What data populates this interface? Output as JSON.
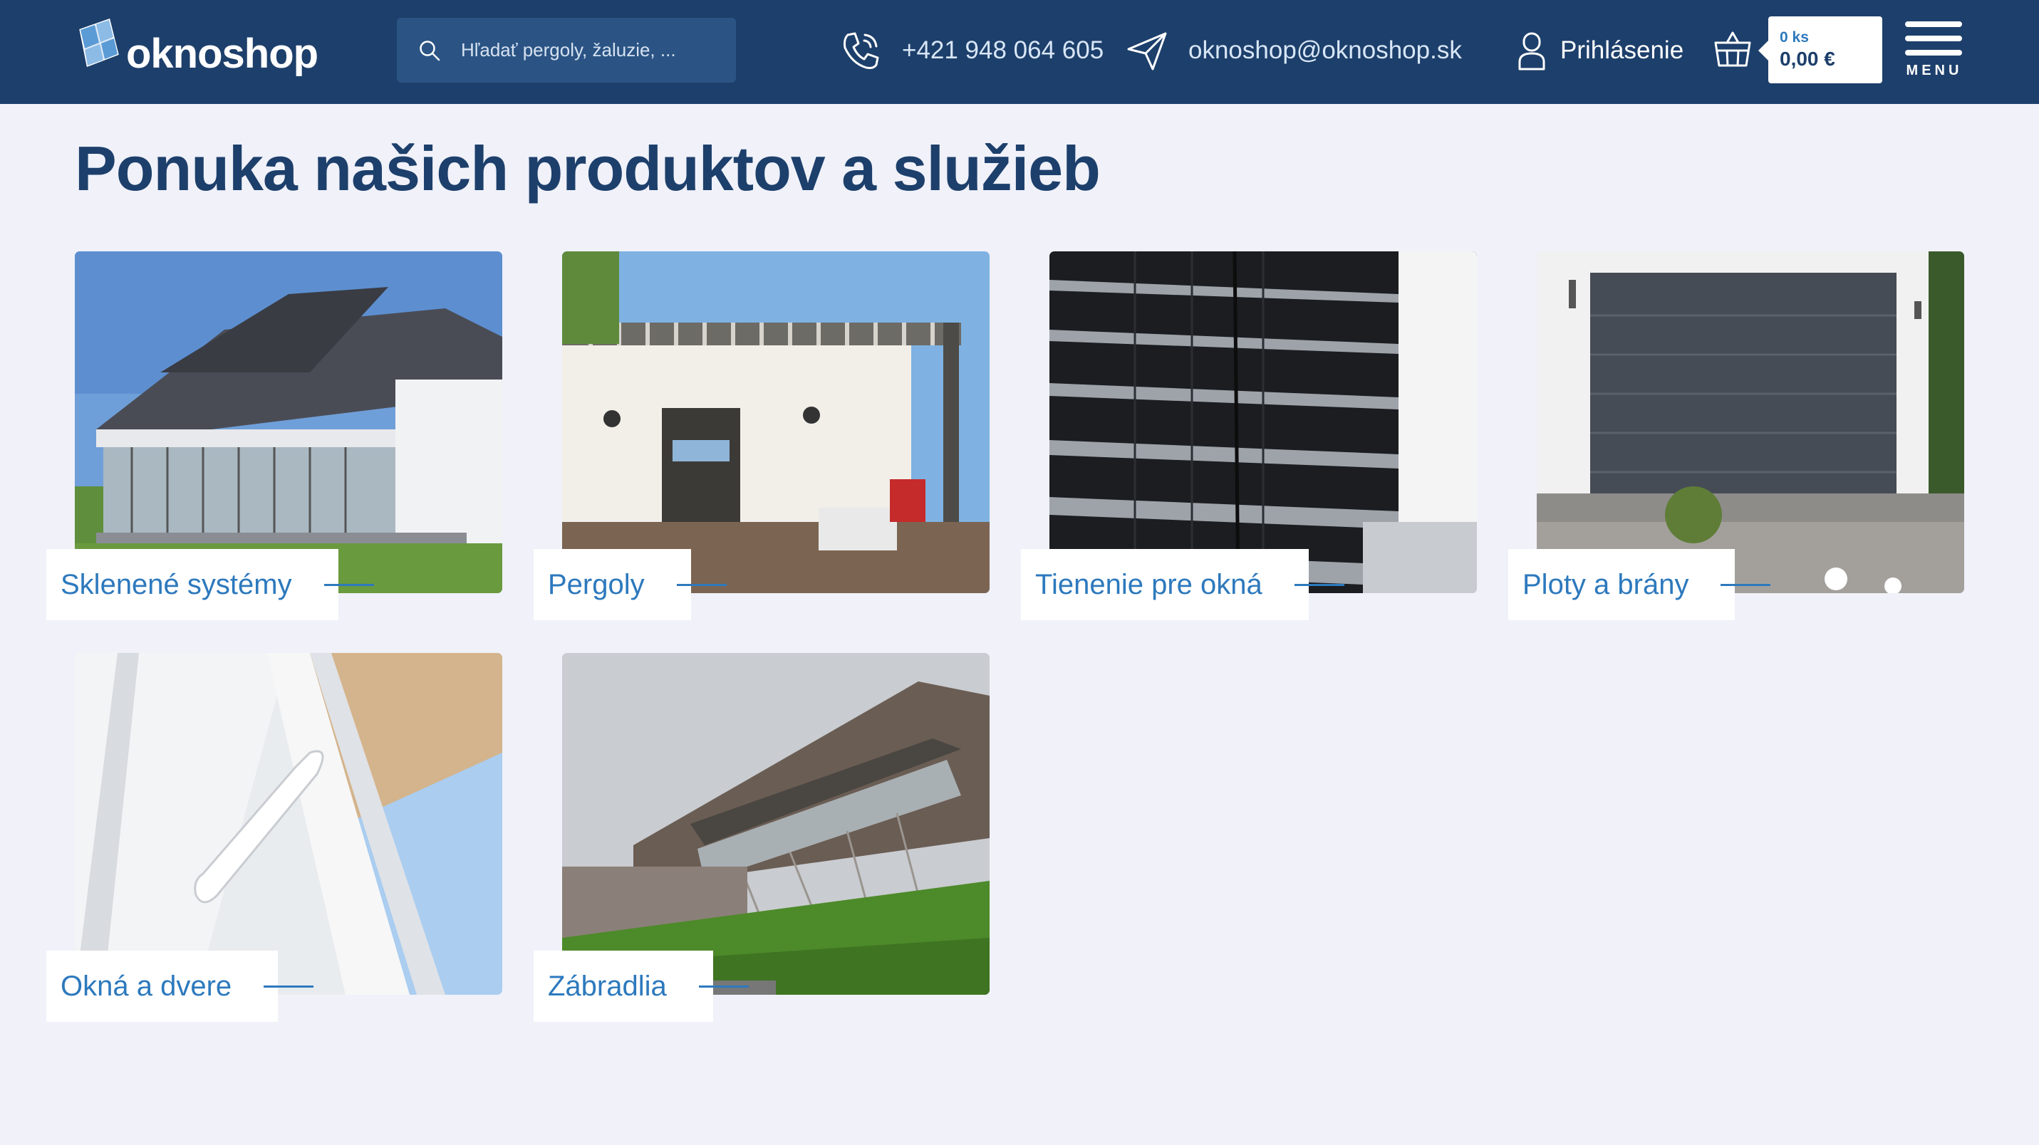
{
  "header": {
    "logo_text": "oknoshop",
    "search_placeholder": "Hľadať pergoly, žaluzie, ...",
    "phone": "+421 948 064 605",
    "email": "oknoshop@oknoshop.sk",
    "login": "Prihlásenie",
    "cart": {
      "count": "0 ks",
      "price": "0,00 €"
    },
    "menu_label": "MENU"
  },
  "page": {
    "title": "Ponuka našich produktov a služieb"
  },
  "products": [
    {
      "label": "Sklenené systémy",
      "image": "glass-systems-house"
    },
    {
      "label": "Pergoly",
      "image": "pergola-terrace"
    },
    {
      "label": "Tienenie pre okná",
      "image": "window-blinds"
    },
    {
      "label": "Ploty a brány",
      "image": "garage-door"
    },
    {
      "label": "Okná a dvere",
      "image": "window-handle"
    },
    {
      "label": "Zábradlia",
      "image": "glass-railing-building"
    }
  ],
  "colors": {
    "header_bg": "#1d3f6b",
    "search_bg": "#2b5484",
    "page_bg": "#f0f1f9",
    "title": "#1d3f6b",
    "accent": "#2d79bd"
  }
}
